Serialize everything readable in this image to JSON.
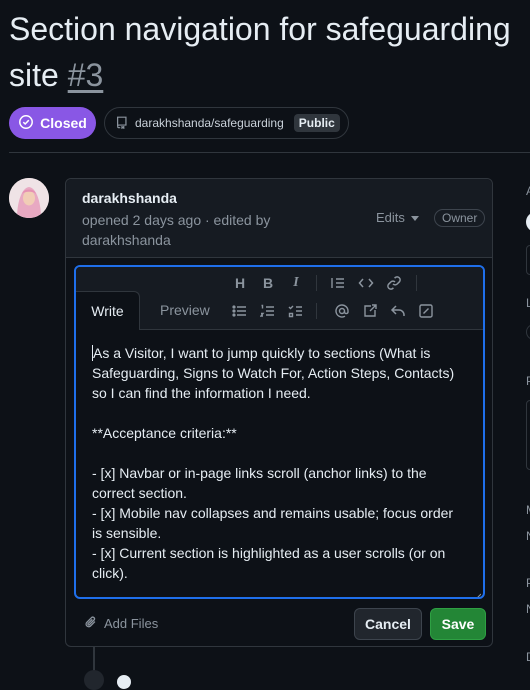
{
  "issue": {
    "title": "Section navigation for safeguarding site",
    "number": "#3",
    "state": "Closed",
    "repo": "darakhshanda/safeguarding",
    "visibility": "Public"
  },
  "comment": {
    "author": "darakhshanda",
    "meta": "opened 2 days ago · edited by darakhshanda",
    "edits_label": "Edits",
    "role_badge": "Owner"
  },
  "editor": {
    "tabs": {
      "write": "Write",
      "preview": "Preview"
    },
    "toolbar": {
      "heading": "H",
      "bold": "B",
      "italic": "I"
    },
    "text_first": "As a Visitor, I want to jump quickly to sections (What is Safeguarding, Signs to Watch For, Action Steps, Contacts) so I can find the information I need.",
    "text_rest": "\n\n**Acceptance criteria:**\n\n- [x] Navbar or in-page links scroll (anchor links) to the correct section.\n- [x] Mobile nav collapses and remains usable; focus order is sensible.\n- [x] Current section is highlighted as a user scrolls (or on click).",
    "add_files": "Add Files",
    "cancel": "Cancel",
    "save": "Save"
  },
  "sidebar_fragments": [
    "A",
    "L",
    "P",
    "M",
    "N",
    "P",
    "N",
    "D"
  ],
  "colors": {
    "background": "#0d1117",
    "closed_badge": "#8957e5",
    "focus_border": "#1f6feb",
    "save_button": "#238636"
  },
  "icons": [
    "closed-issue-icon",
    "repo-icon",
    "triangle-down-icon",
    "paperclip-icon"
  ]
}
